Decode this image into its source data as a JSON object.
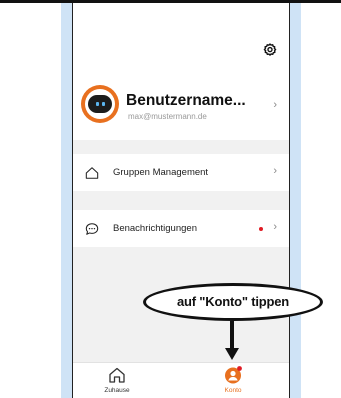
{
  "colors": {
    "backdrop": "#cfe3f6",
    "accent": "#e8701f",
    "notification_dot": "#e01b24",
    "inactive_tab": "#333333"
  },
  "header": {
    "settings_icon": "gear-icon"
  },
  "profile": {
    "username": "Benutzername...",
    "email": "max@mustermann.de",
    "avatar_icon": "robot-avatar-icon"
  },
  "menu": {
    "items": [
      {
        "label": "Gruppen Management",
        "icon": "home-outline-icon",
        "has_dot": false
      },
      {
        "label": "Benachrichtigungen",
        "icon": "chat-bubble-icon",
        "has_dot": true
      }
    ]
  },
  "tabbar": {
    "tabs": [
      {
        "label": "Zuhause",
        "icon": "home-icon",
        "active": false
      },
      {
        "label": "Konto",
        "icon": "account-icon",
        "active": true
      }
    ]
  },
  "annotation": {
    "callout_text": "auf \"Konto\" tippen"
  }
}
